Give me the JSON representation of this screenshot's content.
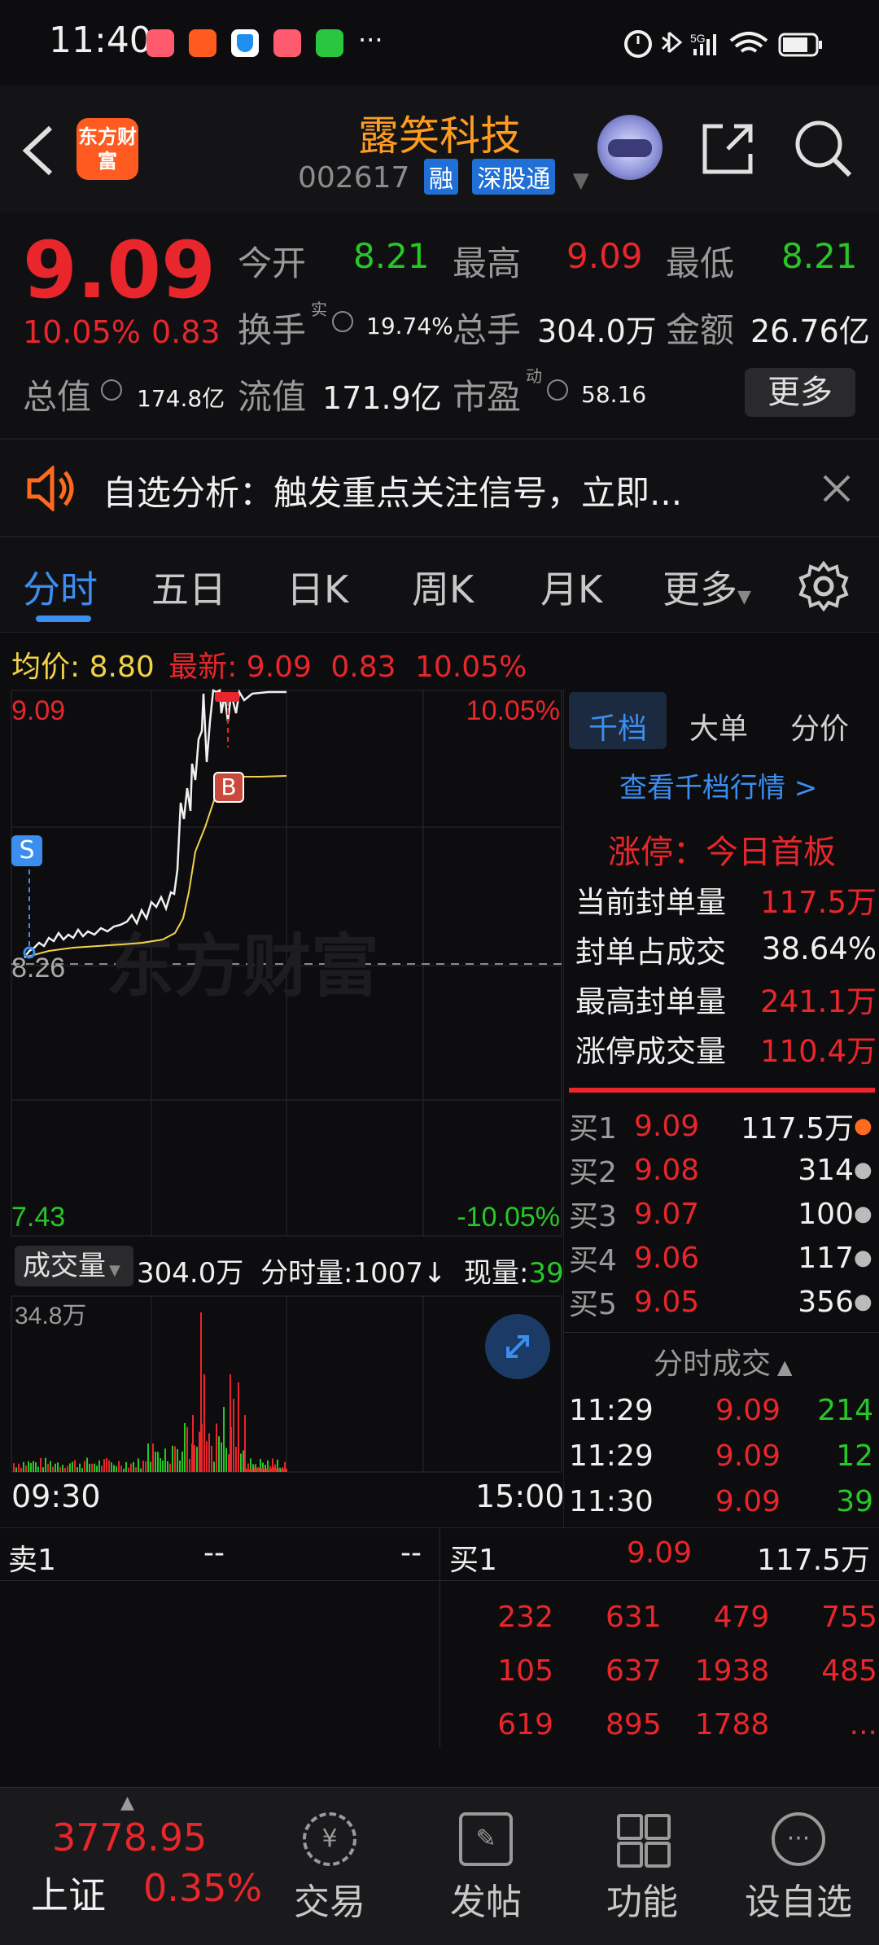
{
  "status_bar": {
    "time": "11:40",
    "more": "···"
  },
  "header": {
    "logo_text": "东方财富",
    "stock_name": "露笑科技",
    "stock_code": "002617",
    "tag1": "融",
    "tag2": "深股通"
  },
  "summary": {
    "price": "9.09",
    "change_pct": "10.05%",
    "change_amt": "0.83",
    "open_label": "今开",
    "open": "8.21",
    "high_label": "最高",
    "high": "9.09",
    "low_label": "最低",
    "low": "8.21",
    "turnover_label": "换手",
    "turnover_sup": "实",
    "turnover": "19.74%",
    "volume_label": "总手",
    "volume": "304.0万",
    "amount_label": "金额",
    "amount": "26.76亿",
    "mktcap_label": "总值",
    "mktcap": "174.8亿",
    "float_label": "流值",
    "float_cap": "171.9亿",
    "pe_label": "市盈",
    "pe_sup": "动",
    "pe": "58.16",
    "more": "更多"
  },
  "notice": {
    "text": "自选分析：触发重点关注信号，立即..."
  },
  "tabs": [
    "分时",
    "五日",
    "日K",
    "周K",
    "月K",
    "更多"
  ],
  "info_line": {
    "avg_label": "均价:",
    "avg": "8.80",
    "latest_label": "最新:",
    "latest": "9.09",
    "chg": "0.83",
    "pct": "10.05%"
  },
  "chart": {
    "top_price": "9.09",
    "top_pct": "10.05%",
    "mid_price": "8.26",
    "bottom_price": "7.43",
    "bottom_pct": "-10.05%",
    "watermark": "东方财富",
    "marker_s": "S",
    "marker_b": "B",
    "vol_selector": "成交量",
    "vol_total": "304.0万",
    "vol_min_label": "分时量:",
    "vol_min": "1007",
    "vol_now_label": "现量:",
    "vol_now": "39",
    "vol_max": "34.8万",
    "time_start": "09:30",
    "time_end": "15:00"
  },
  "right_panel": {
    "tabs": [
      "千档",
      "大单",
      "分价"
    ],
    "view_link": "查看千档行情 >",
    "limit_title": "涨停：今日首板",
    "stats": [
      {
        "label": "当前封单量",
        "value": "117.5万"
      },
      {
        "label": "封单占成交",
        "value": "38.64%"
      },
      {
        "label": "最高封单量",
        "value": "241.1万"
      },
      {
        "label": "涨停成交量",
        "value": "110.4万"
      }
    ],
    "bids": [
      {
        "label": "买1",
        "price": "9.09",
        "vol": "117.5万"
      },
      {
        "label": "买2",
        "price": "9.08",
        "vol": "314"
      },
      {
        "label": "买3",
        "price": "9.07",
        "vol": "100"
      },
      {
        "label": "买4",
        "price": "9.06",
        "vol": "117"
      },
      {
        "label": "买5",
        "price": "9.05",
        "vol": "356"
      }
    ],
    "trades_title": "分时成交",
    "trades": [
      {
        "time": "11:29",
        "price": "9.09",
        "vol": "214"
      },
      {
        "time": "11:29",
        "price": "9.09",
        "vol": "12"
      },
      {
        "time": "11:30",
        "price": "9.09",
        "vol": "39"
      }
    ]
  },
  "level2": {
    "sell_label": "卖1",
    "sell_price": "--",
    "sell_vol": "--",
    "buy_label": "买1",
    "buy_price": "9.09",
    "buy_vol": "117.5万",
    "queue": [
      [
        "232",
        "631",
        "479",
        "755"
      ],
      [
        "105",
        "637",
        "1938",
        "485"
      ],
      [
        "619",
        "895",
        "1788",
        "..."
      ]
    ]
  },
  "bottom_nav": {
    "index_value": "3778.95",
    "index_name": "上证",
    "index_pct": "0.35%",
    "items": [
      "交易",
      "发帖",
      "功能",
      "设自选"
    ]
  }
}
